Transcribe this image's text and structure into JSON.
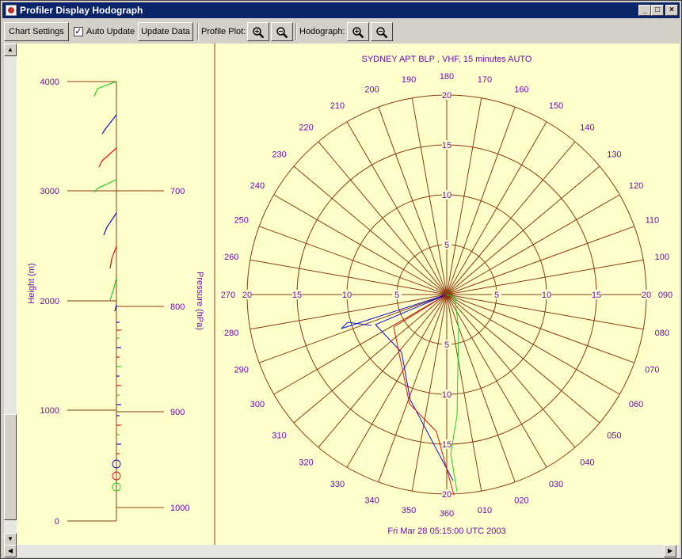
{
  "window": {
    "title": "Profiler Display Hodograph"
  },
  "toolbar": {
    "chart_settings": "Chart Settings",
    "auto_update": "Auto Update",
    "auto_update_checked": true,
    "update_data": "Update Data",
    "profile_plot_label": "Profile Plot:",
    "hodograph_label": "Hodograph:"
  },
  "profile": {
    "y_label": "Height (m)",
    "pressure_label": "Pressure (hPa)",
    "height_ticks": [
      "4000",
      "3000",
      "2000",
      "1000",
      "0"
    ],
    "pressure_ticks": [
      "700",
      "800",
      "900",
      "1000"
    ]
  },
  "hodograph": {
    "title": "SYDNEY APT BLP  , VHF, 15 minutes AUTO",
    "timestamp": "Fri Mar 28 05:15:00 UTC 2003",
    "ring_labels": [
      "5",
      "10",
      "15",
      "20"
    ],
    "direction_labels": [
      "360",
      "010",
      "020",
      "030",
      "040",
      "050",
      "060",
      "070",
      "080",
      "090",
      "100",
      "110",
      "120",
      "130",
      "140",
      "150",
      "160",
      "170",
      "180",
      "190",
      "200",
      "210",
      "220",
      "230",
      "240",
      "250",
      "260",
      "270",
      "280",
      "290",
      "300",
      "310",
      "320",
      "330",
      "340",
      "350"
    ]
  },
  "colors": {
    "title_bar": "#0a246a",
    "chart_bg": "#ffffcc",
    "ring_color": "#8b3a0e",
    "label_color": "#6a0dad",
    "series_red": "#e01010",
    "series_green": "#22cc22",
    "series_blue": "#1010cc"
  }
}
